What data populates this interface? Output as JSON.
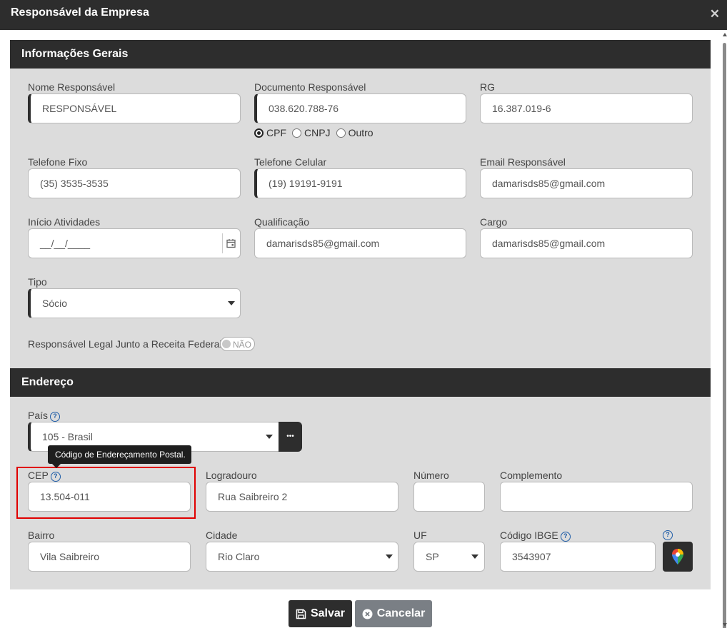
{
  "dialog": {
    "title": "Responsável da Empresa",
    "close_icon": "✕"
  },
  "general": {
    "header": "Informações Gerais",
    "nome": {
      "label": "Nome Responsável",
      "value": "RESPONSÁVEL"
    },
    "documento": {
      "label": "Documento Responsável",
      "value": "038.620.788-76",
      "options": [
        {
          "label": "CPF",
          "selected": true
        },
        {
          "label": "CNPJ",
          "selected": false
        },
        {
          "label": "Outro",
          "selected": false
        }
      ]
    },
    "rg": {
      "label": "RG",
      "value": "16.387.019-6"
    },
    "telefone_fixo": {
      "label": "Telefone Fixo",
      "value": "(35) 3535-3535"
    },
    "telefone_celular": {
      "label": "Telefone Celular",
      "value": "(19) 19191-9191"
    },
    "email": {
      "label": "Email Responsável",
      "value": "damarisds85@gmail.com"
    },
    "inicio": {
      "label": "Início Atividades",
      "value": "__/__/____"
    },
    "qualificacao": {
      "label": "Qualificação",
      "value": "damarisds85@gmail.com"
    },
    "cargo": {
      "label": "Cargo",
      "value": "damarisds85@gmail.com"
    },
    "tipo": {
      "label": "Tipo",
      "value": "Sócio"
    },
    "responsavel_legal": {
      "label": "Responsável Legal Junto a Receita Federal",
      "toggle_text": "NÃO"
    }
  },
  "address": {
    "header": "Endereço",
    "pais": {
      "label": "País",
      "value": "105 - Brasil",
      "more_button": "•••"
    },
    "tooltip": "Código de Endereçamento Postal.",
    "cep": {
      "label": "CEP",
      "value": "13.504-011"
    },
    "logradouro": {
      "label": "Logradouro",
      "value": "Rua Saibreiro 2"
    },
    "numero": {
      "label": "Número",
      "value": ""
    },
    "complemento": {
      "label": "Complemento",
      "value": ""
    },
    "bairro": {
      "label": "Bairro",
      "value": "Vila Saibreiro"
    },
    "cidade": {
      "label": "Cidade",
      "value": "Rio Claro"
    },
    "uf": {
      "label": "UF",
      "value": "SP"
    },
    "ibge": {
      "label": "Código IBGE",
      "value": "3543907"
    },
    "help_glyph": "?"
  },
  "footer": {
    "save": "Salvar",
    "cancel": "Cancelar"
  },
  "colors": {
    "header_bg": "#2d2d2d",
    "section_bg": "#dcdcdc",
    "cancel_bg": "#7a7f85",
    "highlight": "#e00000",
    "help": "#1f5da8"
  }
}
